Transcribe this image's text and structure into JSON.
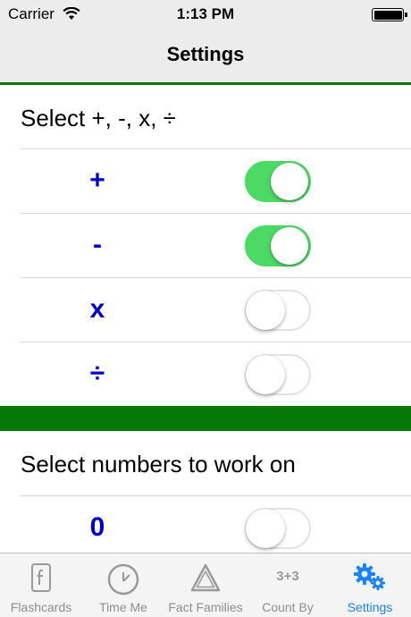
{
  "status_bar": {
    "carrier": "Carrier",
    "time": "1:13 PM"
  },
  "nav": {
    "title": "Settings"
  },
  "sections": [
    {
      "title": "Select +, -, x, ÷"
    },
    {
      "title": "Select numbers to work on"
    }
  ],
  "operations": [
    {
      "label": "+",
      "on": true
    },
    {
      "label": "-",
      "on": true
    },
    {
      "label": "x",
      "on": false
    },
    {
      "label": "÷",
      "on": false
    }
  ],
  "numbers": [
    {
      "label": "0",
      "on": false
    }
  ],
  "tab_bar": {
    "items": [
      {
        "label": "Flashcards",
        "icon": "flashcard-icon"
      },
      {
        "label": "Time Me",
        "icon": "clock-icon"
      },
      {
        "label": "Fact Families",
        "icon": "triangle-icon"
      },
      {
        "label": "Count By",
        "icon": "count-by-icon",
        "icon_text": "3+3"
      },
      {
        "label": "Settings",
        "icon": "gears-icon"
      }
    ],
    "active_index": 4
  },
  "colors": {
    "accent_green": "#067806",
    "switch_on": "#4cd964",
    "label_blue": "#0000cc",
    "tab_active": "#1a82fb",
    "tab_inactive": "#8e8e8e"
  }
}
